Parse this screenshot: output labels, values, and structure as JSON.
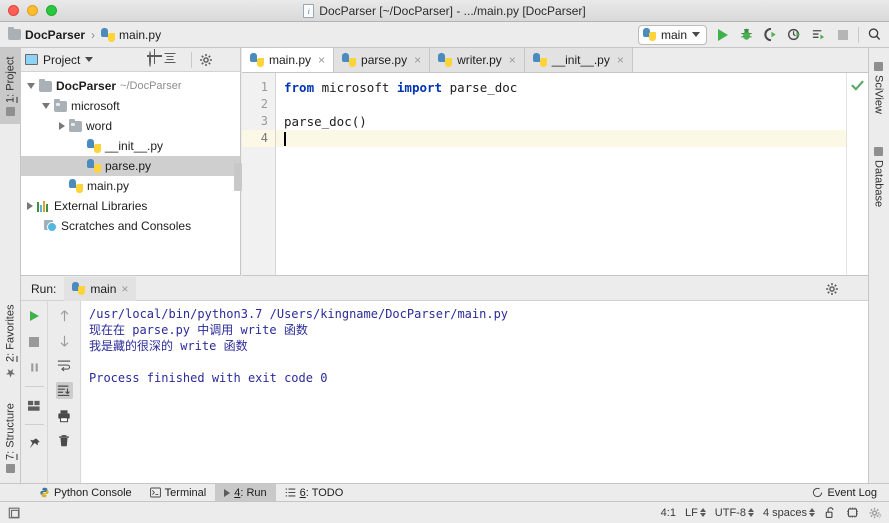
{
  "window": {
    "title": "DocParser [~/DocParser] - .../main.py [DocParser]",
    "title_icon": "py-file-icon"
  },
  "navbar": {
    "breadcrumb": [
      {
        "label": "DocParser",
        "icon": "folder-icon"
      },
      {
        "label": "main.py",
        "icon": "python-file-icon"
      }
    ],
    "separator": "›",
    "run_config": {
      "label": "main",
      "icon": "python-icon"
    },
    "actions": [
      {
        "name": "run-button",
        "icon": "play-icon"
      },
      {
        "name": "debug-button",
        "icon": "bug-icon"
      },
      {
        "name": "run-coverage-button",
        "icon": "coverage-icon"
      },
      {
        "name": "profile-button",
        "icon": "profile-icon"
      },
      {
        "name": "attach-button",
        "icon": "attach-icon"
      },
      {
        "name": "stop-button",
        "icon": "stop-icon"
      },
      {
        "name": "search-everywhere-button",
        "icon": "search-icon"
      }
    ]
  },
  "left_strip": {
    "tabs": [
      {
        "label": "1: Project",
        "underline": "1",
        "icon": "project-icon",
        "active": true
      },
      {
        "label": "2: Favorites",
        "underline": "2",
        "icon": "star-icon",
        "active": false
      },
      {
        "label": "7: Structure",
        "underline": "7",
        "icon": "structure-icon",
        "active": false
      }
    ]
  },
  "right_strip": {
    "tabs": [
      {
        "label": "SciView",
        "icon": "sciview-icon"
      },
      {
        "label": "Database",
        "icon": "database-icon"
      }
    ]
  },
  "project_panel": {
    "header": {
      "title": "Project",
      "view_icon": "project-view-icon",
      "dropdown_icon": "chevron-down-icon",
      "actions": [
        {
          "name": "select-opened-file-button",
          "icon": "target-icon"
        },
        {
          "name": "collapse-all-button",
          "icon": "collapse-all-icon"
        },
        {
          "name": "settings-button",
          "icon": "gear-icon"
        },
        {
          "name": "hide-button",
          "icon": "minus-icon"
        }
      ]
    },
    "tree": [
      {
        "label": "DocParser",
        "path": "~/DocParser",
        "icon": "folder-icon",
        "indent": 0,
        "expander": "down",
        "bold": true,
        "selected": false
      },
      {
        "label": "microsoft",
        "path": "",
        "icon": "source-folder-icon",
        "indent": 1,
        "expander": "down",
        "bold": false,
        "selected": false
      },
      {
        "label": "word",
        "path": "",
        "icon": "source-folder-icon",
        "indent": 2,
        "expander": "right",
        "bold": false,
        "selected": false
      },
      {
        "label": "__init__.py",
        "path": "",
        "icon": "python-file-icon",
        "indent": 3,
        "expander": "none",
        "bold": false,
        "selected": false
      },
      {
        "label": "parse.py",
        "path": "",
        "icon": "python-file-icon",
        "indent": 3,
        "expander": "none",
        "bold": false,
        "selected": true
      },
      {
        "label": "main.py",
        "path": "",
        "icon": "python-file-icon",
        "indent": 2,
        "expander": "none",
        "bold": false,
        "selected": false
      },
      {
        "label": "External Libraries",
        "path": "",
        "icon": "library-icon",
        "indent": 0,
        "expander": "right",
        "bold": false,
        "selected": false
      },
      {
        "label": "Scratches and Consoles",
        "path": "",
        "icon": "scratches-icon",
        "indent": 0,
        "expander": "none",
        "bold": false,
        "selected": false
      }
    ]
  },
  "editor": {
    "tabs": [
      {
        "label": "main.py",
        "icon": "python-file-icon",
        "active": true,
        "close": "×"
      },
      {
        "label": "parse.py",
        "icon": "python-file-icon",
        "active": false,
        "close": "×"
      },
      {
        "label": "writer.py",
        "icon": "python-file-icon",
        "active": false,
        "close": "×"
      },
      {
        "label": "__init__.py",
        "icon": "python-file-icon",
        "active": false,
        "close": "×"
      }
    ],
    "line_numbers": [
      "1",
      "2",
      "3",
      "4"
    ],
    "lines": [
      {
        "n": 1,
        "segments": [
          {
            "t": "from",
            "k": "keyword"
          },
          {
            "t": " microsoft ",
            "k": "plain"
          },
          {
            "t": "import",
            "k": "keyword"
          },
          {
            "t": " parse_doc",
            "k": "plain"
          }
        ],
        "current": false
      },
      {
        "n": 2,
        "segments": [],
        "current": false
      },
      {
        "n": 3,
        "segments": [
          {
            "t": "parse_doc()",
            "k": "plain"
          }
        ],
        "current": false
      },
      {
        "n": 4,
        "segments": [],
        "current": true
      }
    ],
    "inspection_status": "ok-check-icon",
    "current_line_color": "#fcf8e6"
  },
  "run_panel": {
    "label": "Run:",
    "tab": {
      "label": "main",
      "icon": "python-icon",
      "close": "×"
    },
    "header_actions": [
      {
        "name": "run-settings-button",
        "icon": "gear-icon"
      },
      {
        "name": "hide-run-button",
        "icon": "minus-icon"
      }
    ],
    "left_tools": [
      {
        "name": "rerun-button",
        "icon": "play-icon"
      },
      {
        "name": "stop-button",
        "icon": "stop-icon"
      },
      {
        "name": "pause-output-button",
        "icon": "pause-icon"
      },
      {
        "name": "restore-layout-button",
        "icon": "layout-icon"
      },
      {
        "name": "pin-tab-button",
        "icon": "pin-icon"
      }
    ],
    "right_tools": [
      {
        "name": "up-stacktrace-button",
        "icon": "arrow-up-icon"
      },
      {
        "name": "down-stacktrace-button",
        "icon": "arrow-down-icon"
      },
      {
        "name": "soft-wrap-button",
        "icon": "wrap-icon"
      },
      {
        "name": "scroll-to-end-button",
        "icon": "scroll-end-icon",
        "selected": true
      },
      {
        "name": "print-button",
        "icon": "printer-icon"
      },
      {
        "name": "clear-all-button",
        "icon": "trash-icon"
      }
    ],
    "console_lines": [
      "/usr/local/bin/python3.7 /Users/kingname/DocParser/main.py",
      "现在在 parse.py 中调用 write 函数",
      "我是藏的很深的 write 函数",
      "",
      "Process finished with exit code 0"
    ],
    "console_text_color": "#2b2b99"
  },
  "bottom_bar": {
    "tabs": [
      {
        "label": "Python Console",
        "underline": "",
        "icon": "python-console-icon",
        "active": false
      },
      {
        "label": "Terminal",
        "underline": "",
        "icon": "terminal-icon",
        "active": false
      },
      {
        "label": "4: Run",
        "underline": "4",
        "icon": "play-icon",
        "active": true
      },
      {
        "label": "6: TODO",
        "underline": "6",
        "icon": "todo-icon",
        "active": false
      }
    ],
    "event_log": {
      "label": "Event Log",
      "icon": "event-log-icon"
    }
  },
  "status_bar": {
    "left_icon": "toggle-toolwindows-icon",
    "caret_position": "4:1",
    "line_separator": "LF",
    "encoding": "UTF-8",
    "indent": "4 spaces",
    "items": [
      {
        "name": "caret-position",
        "value": "4:1",
        "chooser": false
      },
      {
        "name": "line-separator",
        "value": "LF",
        "chooser": true
      },
      {
        "name": "encoding",
        "value": "UTF-8",
        "chooser": true
      },
      {
        "name": "indent-setting",
        "value": "4 spaces",
        "chooser": true
      }
    ],
    "icons": [
      {
        "name": "lock-icon"
      },
      {
        "name": "memory-indicator-icon"
      },
      {
        "name": "ide-settings-icon"
      }
    ]
  },
  "colors": {
    "chrome": "#ececec",
    "panel_bg": "#ffffff",
    "selection": "#cfcfcf",
    "keyword": "#0033b3",
    "console": "#2b2b99",
    "accent_green": "#3eb14b",
    "current_line": "#fcf8e6"
  }
}
